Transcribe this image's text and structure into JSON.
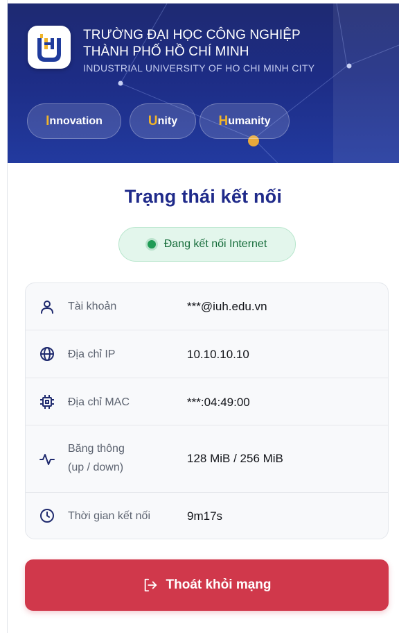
{
  "header": {
    "name_line1": "TRƯỜNG ĐẠI HỌC CÔNG NGHIỆP",
    "name_line2": "THÀNH PHỐ HỒ CHÍ MINH",
    "name_en": "INDUSTRIAL UNIVERSITY OF HO CHI MINH CITY",
    "values": [
      {
        "first": "I",
        "rest": "nnovation"
      },
      {
        "first": "U",
        "rest": "nity"
      },
      {
        "first": "H",
        "rest": "umanity"
      }
    ]
  },
  "main": {
    "title": "Trạng thái kết nối",
    "status": "Đang kết nối Internet",
    "rows": [
      {
        "icon": "user-icon",
        "label": "Tài khoản",
        "value": "***@iuh.edu.vn"
      },
      {
        "icon": "globe-icon",
        "label": "Địa chỉ IP",
        "value": "10.10.10.10"
      },
      {
        "icon": "chip-icon",
        "label": "Địa chỉ MAC",
        "value": "***:04:49:00"
      },
      {
        "icon": "activity-icon",
        "label_line1": "Băng thông",
        "label_line2": "(up / down)",
        "value": "128 MiB / 256 MiB"
      },
      {
        "icon": "clock-icon",
        "label": "Thời gian kết nối",
        "value": "9m17s"
      }
    ],
    "logout_label": "Thoát khỏi mạng"
  },
  "colors": {
    "header_bg": "#1d2c84",
    "accent_yellow": "#f0b429",
    "title_blue": "#1f2a8a",
    "status_green": "#1f9b55",
    "logout_red": "#d0384b"
  }
}
